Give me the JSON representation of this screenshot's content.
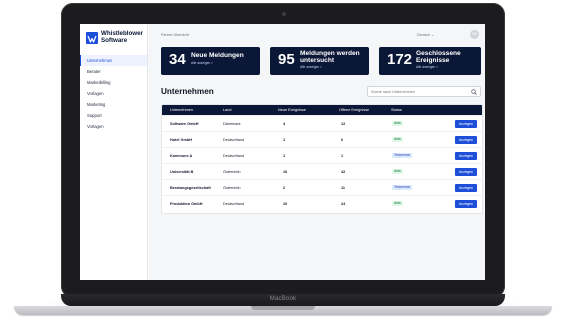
{
  "app": {
    "logo_line1": "Whistleblower",
    "logo_line2": "Software",
    "breadcrumb": "Partner Übersicht",
    "language": "Deutsch ⌄",
    "avatar_initials": "DR",
    "laptop_brand": "MacBook"
  },
  "sidebar": {
    "items": [
      {
        "label": "Unternehmen"
      },
      {
        "label": "Berater"
      },
      {
        "label": "Marketbilling"
      },
      {
        "label": "Vorlagen"
      },
      {
        "label": "Marketing"
      },
      {
        "label": "Support"
      },
      {
        "label": "Vorlagen"
      }
    ]
  },
  "stats": [
    {
      "number": "34",
      "label1": "Neue Meldungen",
      "label2": "",
      "link": "Alle anzeigen >"
    },
    {
      "number": "95",
      "label1": "Meldungen werden",
      "label2": "untersucht",
      "link": "Alle anzeigen >"
    },
    {
      "number": "172",
      "label1": "Geschlossene",
      "label2": "Ereignisse",
      "link": "Alle anzeigen >"
    }
  ],
  "companies": {
    "title": "Unternehmen",
    "search_placeholder": "Suche nach Unternehmen",
    "headers": [
      "Unternehmen",
      "Land",
      "Neue Ereignisse",
      "Offene Ereignisse",
      "Status"
    ],
    "rows": [
      {
        "name": "Software GmbH",
        "country": "Dänemark",
        "new": "4",
        "open": "12",
        "status": "Aktiv",
        "action": "Anzeigen"
      },
      {
        "name": "Hotel GmbH",
        "country": "Deutschland",
        "new": "1",
        "open": "6",
        "status": "Aktiv",
        "action": "Anzeigen"
      },
      {
        "name": "Kommune A",
        "country": "Deutschland",
        "new": "1",
        "open": "1",
        "status": "Testversion",
        "action": "Anzeigen"
      },
      {
        "name": "Universität B",
        "country": "Österreich",
        "new": "16",
        "open": "42",
        "status": "Aktiv",
        "action": "Anzeigen"
      },
      {
        "name": "Beratungsgesellschaft",
        "country": "Österreich",
        "new": "2",
        "open": "11",
        "status": "Testversion",
        "action": "Anzeigen"
      },
      {
        "name": "Produktion GmbH",
        "country": "Deutschland",
        "new": "10",
        "open": "24",
        "status": "Aktiv",
        "action": "Anzeigen"
      }
    ]
  },
  "colors": {
    "navy": "#0b1736",
    "accent": "#1d4ed8",
    "active_badge": "#dcfce7",
    "trial_badge": "#dbeafe"
  }
}
